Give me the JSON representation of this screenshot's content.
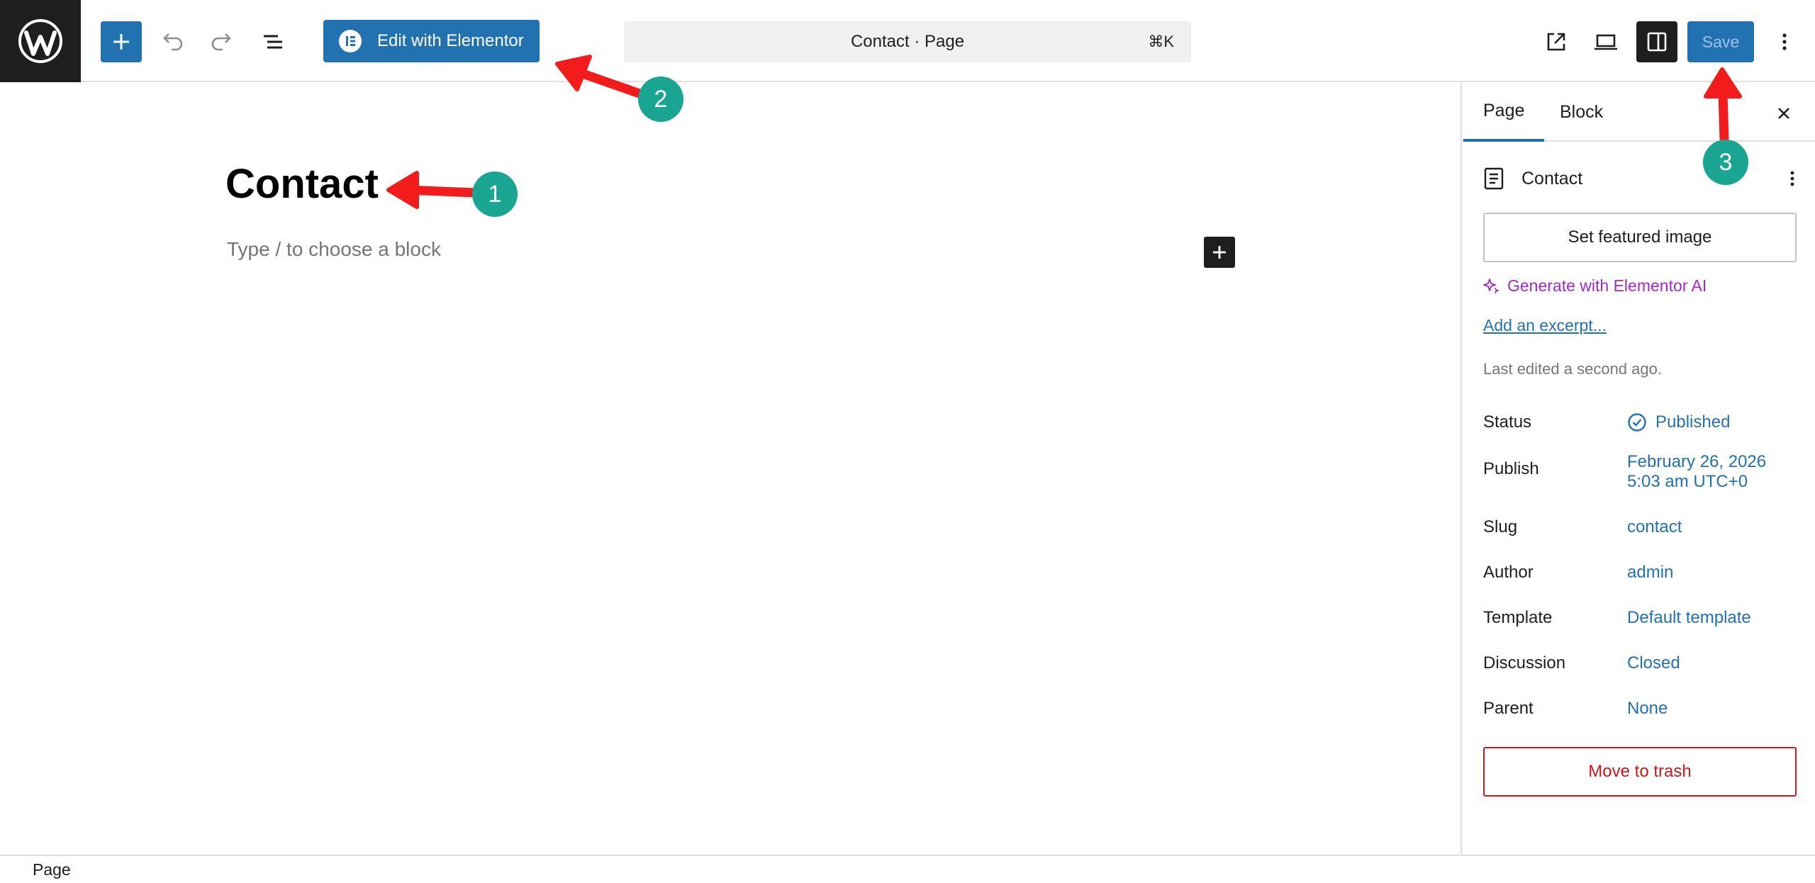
{
  "toolbar": {
    "edit_with_elementor_label": "Edit with Elementor",
    "document_title": "Contact · Page",
    "command_shortcut": "⌘K",
    "save_label": "Save"
  },
  "editor": {
    "page_title": "Contact",
    "block_placeholder": "Type / to choose a block"
  },
  "sidebar": {
    "tabs": [
      {
        "label": "Page"
      },
      {
        "label": "Block"
      }
    ],
    "document_title": "Contact",
    "featured_image_label": "Set featured image",
    "ai_label": "Generate with Elementor AI",
    "excerpt_label": "Add an excerpt...",
    "last_edited": "Last edited a second ago.",
    "meta": {
      "status": {
        "label": "Status",
        "value": "Published"
      },
      "publish": {
        "label": "Publish",
        "date": "February 26, 2026",
        "time": "5:03 am UTC+0"
      },
      "slug": {
        "label": "Slug",
        "value": "contact"
      },
      "author": {
        "label": "Author",
        "value": "admin"
      },
      "template": {
        "label": "Template",
        "value": "Default template"
      },
      "discussion": {
        "label": "Discussion",
        "value": "Closed"
      },
      "parent": {
        "label": "Parent",
        "value": "None"
      }
    },
    "trash_label": "Move to trash"
  },
  "footer": {
    "breadcrumb": "Page"
  },
  "annotations": {
    "step1": "1",
    "step2": "2",
    "step3": "3"
  },
  "colors": {
    "accent": "#2271b1",
    "annotation_arrow": "#f21c1c",
    "annotation_badge": "#1aa592",
    "ai_purple": "#a22ac4",
    "danger": "#cc1818"
  }
}
